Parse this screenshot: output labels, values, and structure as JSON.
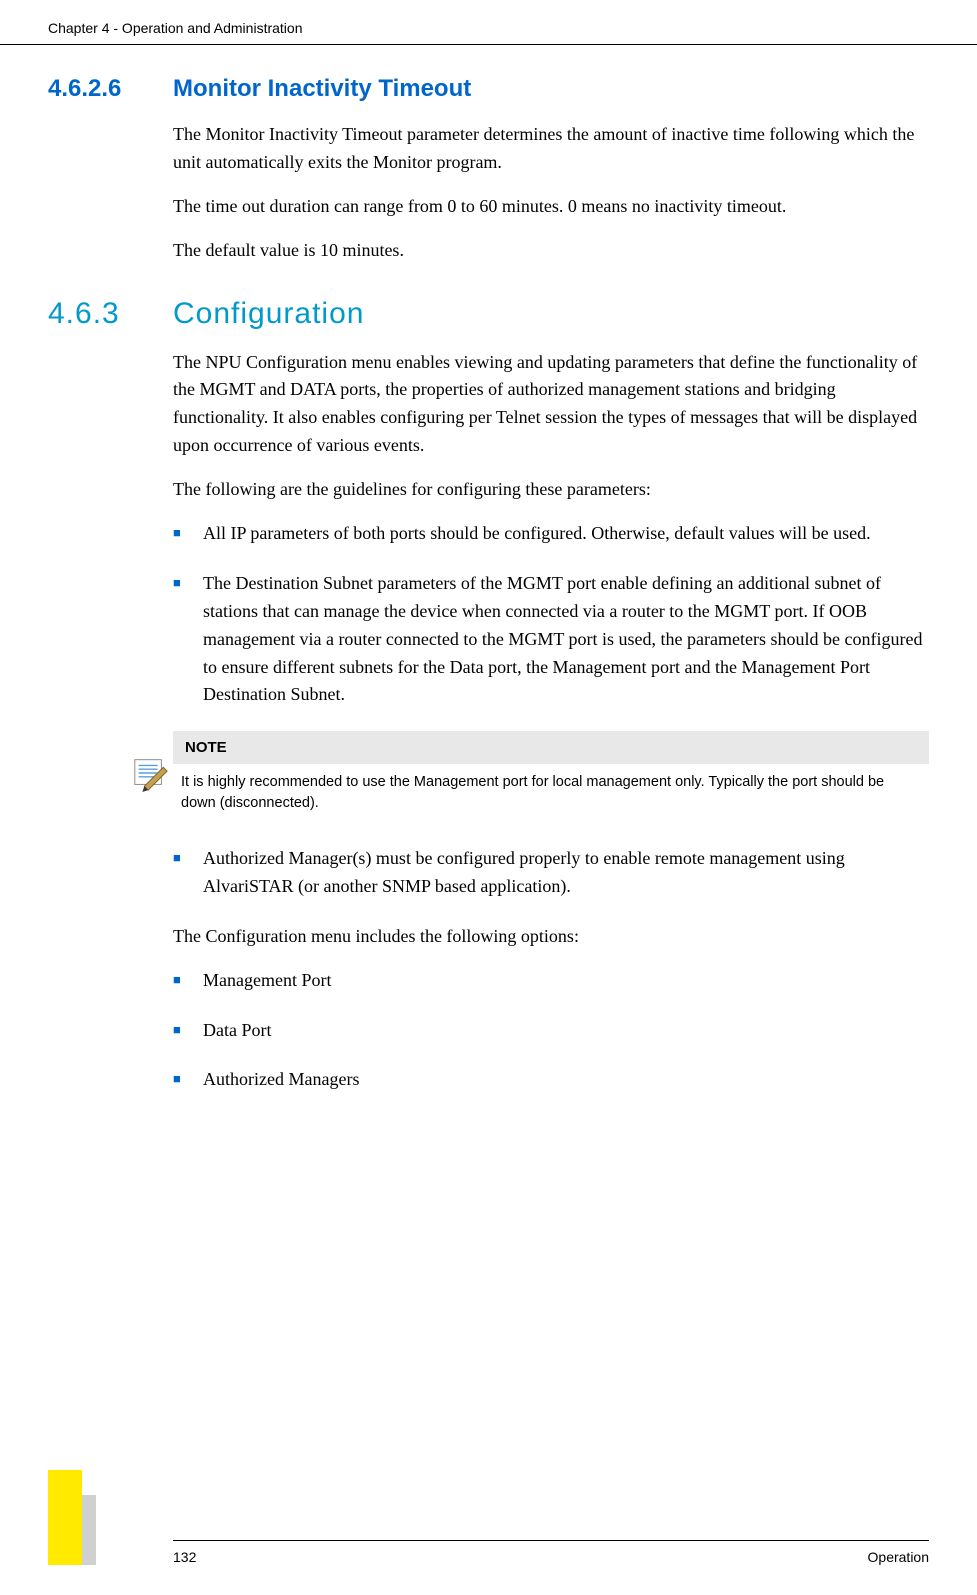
{
  "header": {
    "chapter_text": "Chapter 4 - Operation and Administration"
  },
  "section_4626": {
    "number": "4.6.2.6",
    "title": "Monitor Inactivity Timeout",
    "para1": "The Monitor Inactivity Timeout parameter determines the amount of inactive time following which the unit automatically exits the Monitor program.",
    "para2": "The time out duration can range from 0 to 60 minutes. 0 means no inactivity timeout.",
    "para3": "The default value is 10 minutes."
  },
  "section_463": {
    "number": "4.6.3",
    "title": "Configuration",
    "para1": "The NPU Configuration menu enables viewing and updating parameters that define the functionality of the MGMT and DATA ports, the properties of authorized management stations and bridging functionality. It also enables configuring per Telnet session the types of messages that will be displayed upon occurrence of various events.",
    "para2": "The following are the guidelines for configuring these parameters:",
    "bullets1": [
      "All IP parameters of both ports should be configured. Otherwise, default values will be used.",
      "The Destination Subnet parameters of the MGMT port enable defining an additional subnet of stations that can manage the device when connected via a router to the MGMT port. If OOB management via a router connected to the MGMT port is used, the parameters should be configured to ensure different subnets for the Data port, the Management port and the Management Port Destination Subnet."
    ],
    "note": {
      "label": "NOTE",
      "text": "It is highly recommended to use the Management port for local management only. Typically the port should be down (disconnected)."
    },
    "bullets2": [
      "Authorized Manager(s) must be configured properly to enable remote management using AlvariSTAR (or another SNMP based application)."
    ],
    "para3": "The Configuration menu includes the following options:",
    "bullets3": [
      "Management Port",
      "Data Port",
      "Authorized Managers"
    ]
  },
  "footer": {
    "page_number": "132",
    "section_name": "Operation"
  }
}
